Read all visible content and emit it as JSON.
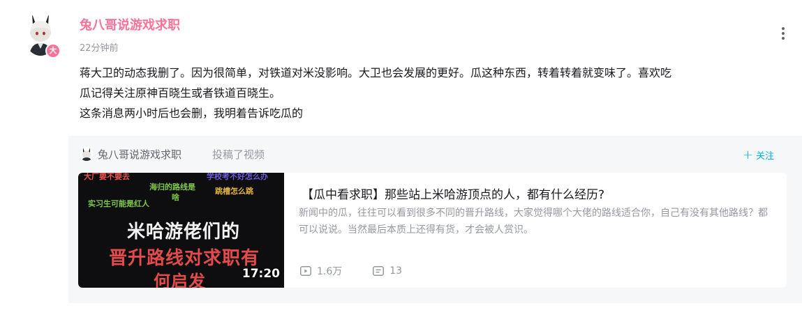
{
  "post": {
    "author": "兔八哥说游戏求职",
    "badge": "大",
    "time": "22分钟前",
    "text_lines": [
      "蒋大卫的动态我删了。因为很简单，对铁道对米没影响。大卫也会发展的更好。瓜这种东西，转着转着就变味了。喜欢吃",
      "瓜记得关注原神百晓生或者铁道百晓生。",
      "这条消息两小时后也会删，我明着告诉吃瓜的"
    ]
  },
  "repost": {
    "author": "兔八哥说游戏求职",
    "action": "投稿了视频",
    "follow_label": "关注",
    "video": {
      "title": "【瓜中看求职】那些站上米哈游顶点的人，都有什么经历?",
      "description": "新闻中的瓜，往往可以看到很多不同的晋升路线，大家觉得哪个大佬的路线适合你，自己有没有其他路线？都可以说说。当然最后本质上还得有货，才会被人赏识。",
      "duration": "17:20",
      "views": "1.6万",
      "comments": "13",
      "thumbnail_text": {
        "tag1": "大厂要不要去",
        "tag2": "学校考不好怎么办",
        "tag3": "海归的路线是",
        "tag4": "啥",
        "tag5": "跳槽怎么跳",
        "tag6": "实习生可能是红人",
        "line1": "米哈游佬们的",
        "line2": "晋升路线对求职有",
        "line3": "何启发"
      }
    }
  },
  "colors": {
    "author": "#fb7299",
    "accent": "#00aeec",
    "muted": "#9499a0",
    "repost_bg": "#f6f7f8"
  },
  "icons": {
    "more": "more-vertical-icon",
    "follow": "plus-icon",
    "views": "play-icon",
    "comments": "comment-icon"
  }
}
